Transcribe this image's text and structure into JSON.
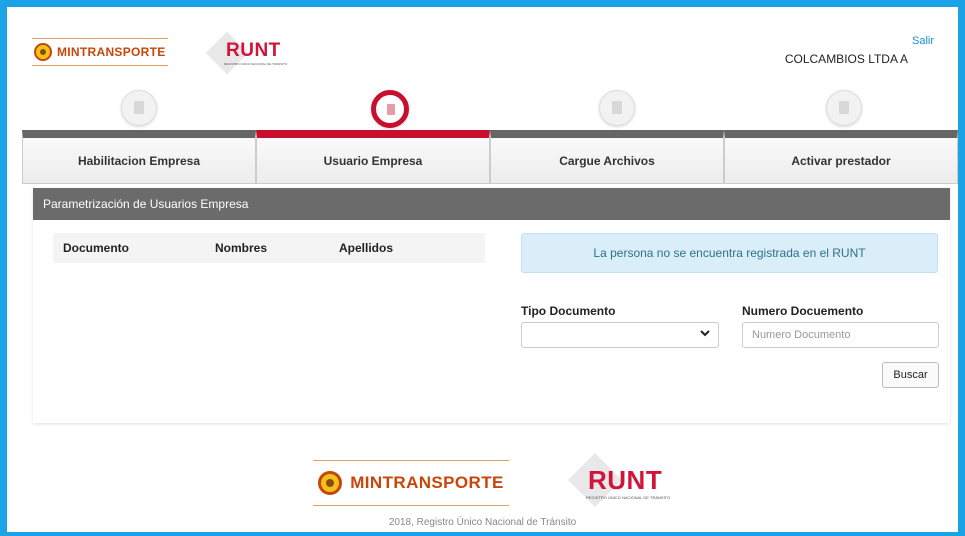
{
  "header": {
    "mintransporte_logo": "MINTRANSPORTE",
    "runt_logo": "RUNT",
    "runt_logo_sub": "REGISTRO ÚNICO NACIONAL DE TRÁNSITO",
    "logout_label": "Salir",
    "company_name": "COLCAMBIOS LTDA A"
  },
  "steps": [
    {
      "label": "Habilitacion Empresa",
      "active": false
    },
    {
      "label": "Usuario Empresa",
      "active": true
    },
    {
      "label": "Cargue Archivos",
      "active": false
    },
    {
      "label": "Activar prestador",
      "active": false
    }
  ],
  "colors": {
    "accent": "#c8102e",
    "frame": "#1aa3e6",
    "panel_header": "#6b6b6b",
    "alert_bg": "#d9eef8"
  },
  "panel": {
    "title": "Parametrización de Usuarios Empresa",
    "table": {
      "columns": [
        "Documento",
        "Nombres",
        "Apellidos"
      ],
      "rows": []
    },
    "alert": "La persona no se encuentra registrada en el RUNT",
    "form": {
      "tipo_documento_label": "Tipo Documento",
      "tipo_documento_value": "",
      "numero_documento_label": "Numero Docuemento",
      "numero_documento_placeholder": "Numero Documento",
      "numero_documento_value": "",
      "search_button": "Buscar"
    }
  },
  "footer": {
    "mintransporte_logo": "MINTRANSPORTE",
    "runt_logo": "RUNT",
    "runt_logo_sub": "REGISTRO ÚNICO NACIONAL DE TRÁNSITO",
    "copyright": "2018, Registro Único Nacional de Tránsito"
  }
}
